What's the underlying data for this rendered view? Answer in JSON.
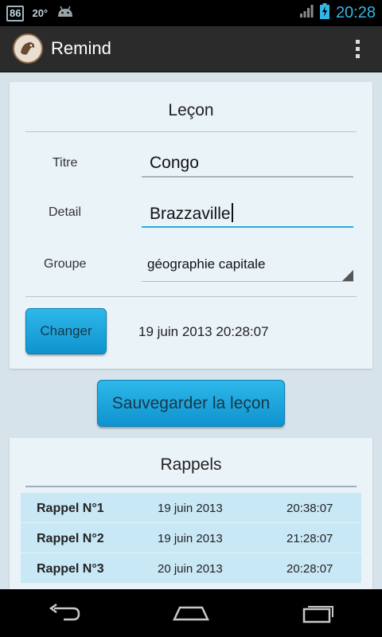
{
  "status_bar": {
    "notification_badge": "86",
    "temperature": "20°",
    "time": "20:28"
  },
  "action_bar": {
    "title": "Remind"
  },
  "lesson": {
    "header": "Leçon",
    "titre_label": "Titre",
    "titre_value": "Congo",
    "detail_label": "Detail",
    "detail_value": "Brazzaville",
    "groupe_label": "Groupe",
    "groupe_value": "géographie capitale",
    "change_button": "Changer",
    "datetime": "19 juin 2013 20:28:07"
  },
  "save_button": "Sauvegarder la leçon",
  "rappels": {
    "header": "Rappels",
    "rows": [
      {
        "name": "Rappel N°1",
        "date": "19 juin 2013",
        "time": "20:38:07"
      },
      {
        "name": "Rappel N°2",
        "date": "19 juin 2013",
        "time": "21:28:07"
      },
      {
        "name": "Rappel N°3",
        "date": "20 juin 2013",
        "time": "20:28:07"
      }
    ]
  }
}
